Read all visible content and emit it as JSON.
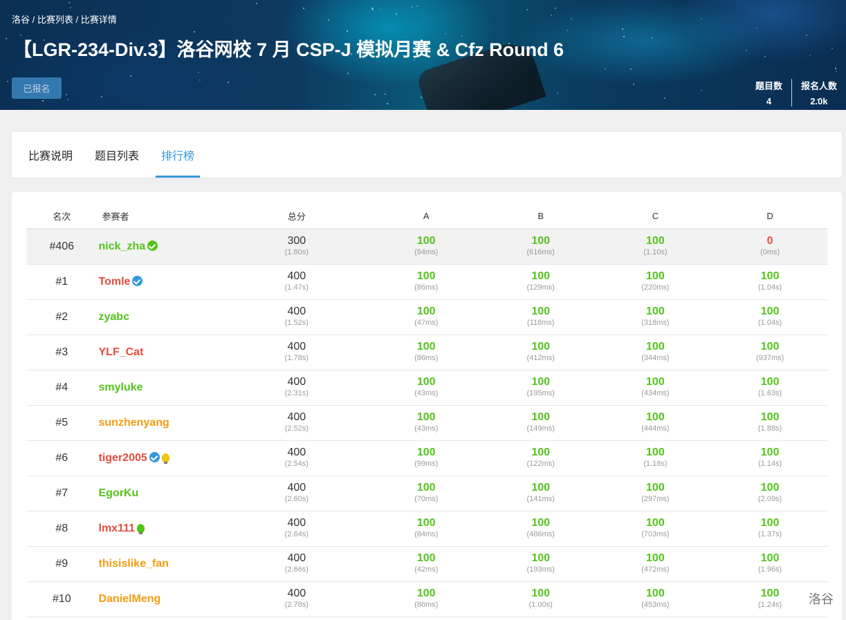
{
  "breadcrumb": {
    "home": "洛谷",
    "list": "比赛列表",
    "detail": "比赛详情",
    "sep": " / "
  },
  "contest": {
    "title": "【LGR-234-Div.3】洛谷网校 7 月 CSP-J 模拟月赛 & Cfz Round 6",
    "status_button": "已报名",
    "problem_count_label": "题目数",
    "problem_count": "4",
    "registrants_label": "报名人数",
    "registrants": "2.0k"
  },
  "tabs": [
    {
      "label": "比赛说明",
      "active": false
    },
    {
      "label": "题目列表",
      "active": false
    },
    {
      "label": "排行榜",
      "active": true
    }
  ],
  "ranklist": {
    "headers": {
      "rank": "名次",
      "participant": "参赛者",
      "total": "总分",
      "A": "A",
      "B": "B",
      "C": "C",
      "D": "D"
    },
    "rows": [
      {
        "rank": "#406",
        "name": "nick_zha",
        "name_color": "#52c41a",
        "badge": "check-green",
        "self": true,
        "total": "300",
        "total_time": "(1.80s)",
        "A": [
          "100",
          "(84ms)"
        ],
        "B": [
          "100",
          "(616ms)"
        ],
        "C": [
          "100",
          "(1.10s)"
        ],
        "D": [
          "0",
          "(0ms)"
        ]
      },
      {
        "rank": "#1",
        "name": "Tomle",
        "name_color": "#e74c3c",
        "badge": "check-blue",
        "total": "400",
        "total_time": "(1.47s)",
        "A": [
          "100",
          "(86ms)"
        ],
        "B": [
          "100",
          "(129ms)"
        ],
        "C": [
          "100",
          "(220ms)"
        ],
        "D": [
          "100",
          "(1.04s)"
        ]
      },
      {
        "rank": "#2",
        "name": "zyabc",
        "name_color": "#52c41a",
        "badge": "",
        "total": "400",
        "total_time": "(1.52s)",
        "A": [
          "100",
          "(47ms)"
        ],
        "B": [
          "100",
          "(118ms)"
        ],
        "C": [
          "100",
          "(318ms)"
        ],
        "D": [
          "100",
          "(1.04s)"
        ]
      },
      {
        "rank": "#3",
        "name": "YLF_Cat",
        "name_color": "#e74c3c",
        "badge": "",
        "total": "400",
        "total_time": "(1.78s)",
        "A": [
          "100",
          "(86ms)"
        ],
        "B": [
          "100",
          "(412ms)"
        ],
        "C": [
          "100",
          "(344ms)"
        ],
        "D": [
          "100",
          "(937ms)"
        ]
      },
      {
        "rank": "#4",
        "name": "smyluke",
        "name_color": "#52c41a",
        "badge": "",
        "total": "400",
        "total_time": "(2.31s)",
        "A": [
          "100",
          "(43ms)"
        ],
        "B": [
          "100",
          "(195ms)"
        ],
        "C": [
          "100",
          "(434ms)"
        ],
        "D": [
          "100",
          "(1.63s)"
        ]
      },
      {
        "rank": "#5",
        "name": "sunzhenyang",
        "name_color": "#f39c11",
        "badge": "",
        "total": "400",
        "total_time": "(2.52s)",
        "A": [
          "100",
          "(43ms)"
        ],
        "B": [
          "100",
          "(149ms)"
        ],
        "C": [
          "100",
          "(444ms)"
        ],
        "D": [
          "100",
          "(1.88s)"
        ]
      },
      {
        "rank": "#6",
        "name": "tiger2005",
        "name_color": "#e74c3c",
        "badge": "check-blue",
        "bulb": "#f1c40f",
        "total": "400",
        "total_time": "(2.54s)",
        "A": [
          "100",
          "(99ms)"
        ],
        "B": [
          "100",
          "(122ms)"
        ],
        "C": [
          "100",
          "(1.18s)"
        ],
        "D": [
          "100",
          "(1.14s)"
        ]
      },
      {
        "rank": "#7",
        "name": "EgorKu",
        "name_color": "#52c41a",
        "badge": "",
        "total": "400",
        "total_time": "(2.60s)",
        "A": [
          "100",
          "(70ms)"
        ],
        "B": [
          "100",
          "(141ms)"
        ],
        "C": [
          "100",
          "(297ms)"
        ],
        "D": [
          "100",
          "(2.09s)"
        ]
      },
      {
        "rank": "#8",
        "name": "lmx111",
        "name_color": "#e74c3c",
        "badge": "",
        "bulb": "#52c41a",
        "total": "400",
        "total_time": "(2.64s)",
        "A": [
          "100",
          "(84ms)"
        ],
        "B": [
          "100",
          "(486ms)"
        ],
        "C": [
          "100",
          "(703ms)"
        ],
        "D": [
          "100",
          "(1.37s)"
        ]
      },
      {
        "rank": "#9",
        "name": "thisislike_fan",
        "name_color": "#f39c11",
        "badge": "",
        "total": "400",
        "total_time": "(2.66s)",
        "A": [
          "100",
          "(42ms)"
        ],
        "B": [
          "100",
          "(193ms)"
        ],
        "C": [
          "100",
          "(472ms)"
        ],
        "D": [
          "100",
          "(1.96s)"
        ]
      },
      {
        "rank": "#10",
        "name": "DanielMeng",
        "name_color": "#f39c11",
        "badge": "",
        "total": "400",
        "total_time": "(2.78s)",
        "A": [
          "100",
          "(86ms)"
        ],
        "B": [
          "100",
          "(1.00s)"
        ],
        "C": [
          "100",
          "(453ms)"
        ],
        "D": [
          "100",
          "(1.24s)"
        ]
      }
    ]
  },
  "watermark": "洛谷",
  "colors": {
    "accent": "#3498db",
    "full_score": "#52c41a",
    "zero_score": "#e74c3c",
    "check_green": "#52c41a",
    "check_blue": "#3498db"
  }
}
